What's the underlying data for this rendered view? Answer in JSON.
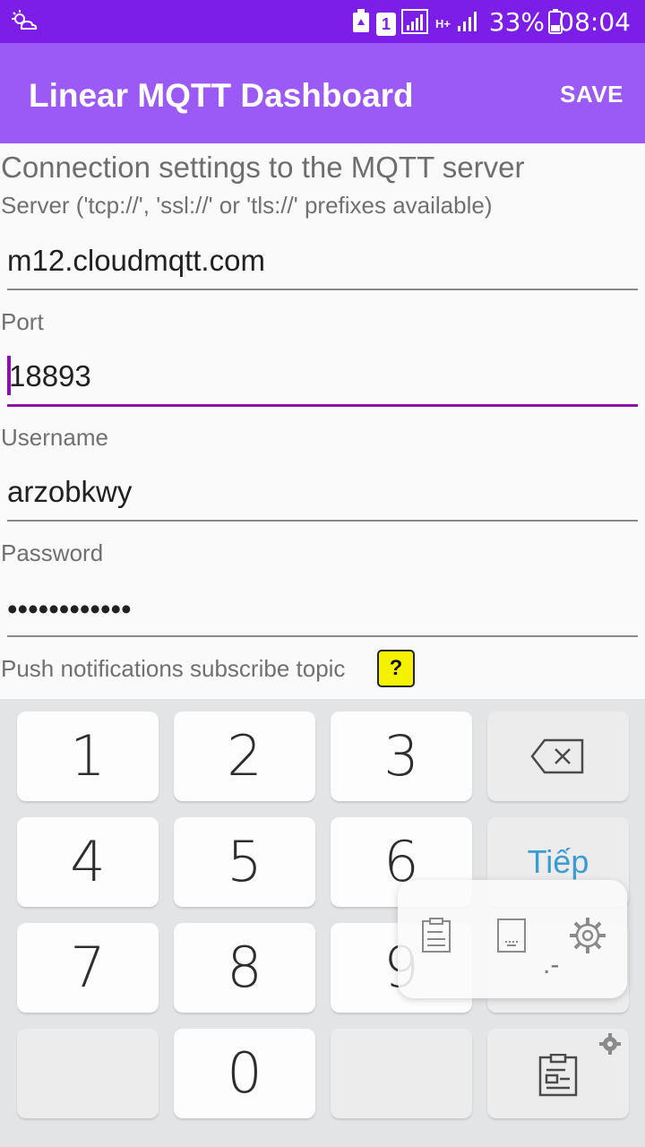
{
  "status_bar": {
    "time": "08:04",
    "battery_percent": "33%",
    "sim_slot": "1",
    "network_type": "H+"
  },
  "app_bar": {
    "title": "Linear MQTT Dashboard",
    "save_label": "SAVE"
  },
  "form": {
    "heading": "Connection settings to the MQTT server",
    "server_label": "Server ('tcp://', 'ssl://' or 'tls://' prefixes available)",
    "server_value": "m12.cloudmqtt.com",
    "port_label": "Port",
    "port_value": "18893",
    "username_label": "Username",
    "username_value": "arzobkwy",
    "password_label": "Password",
    "password_value": "••••••••••••",
    "push_topic_label": "Push notifications subscribe topic",
    "help_label": "?"
  },
  "keyboard": {
    "keys": [
      "1",
      "2",
      "3",
      "4",
      "5",
      "6",
      "7",
      "8",
      "9",
      "0"
    ],
    "next_label": "Tiếp",
    "dot_dash": ".-"
  },
  "colors": {
    "status_bar": "#7c1de8",
    "app_bar": "#9b59f5",
    "accent": "#8b0fa8",
    "help_badge": "#f5f200"
  }
}
